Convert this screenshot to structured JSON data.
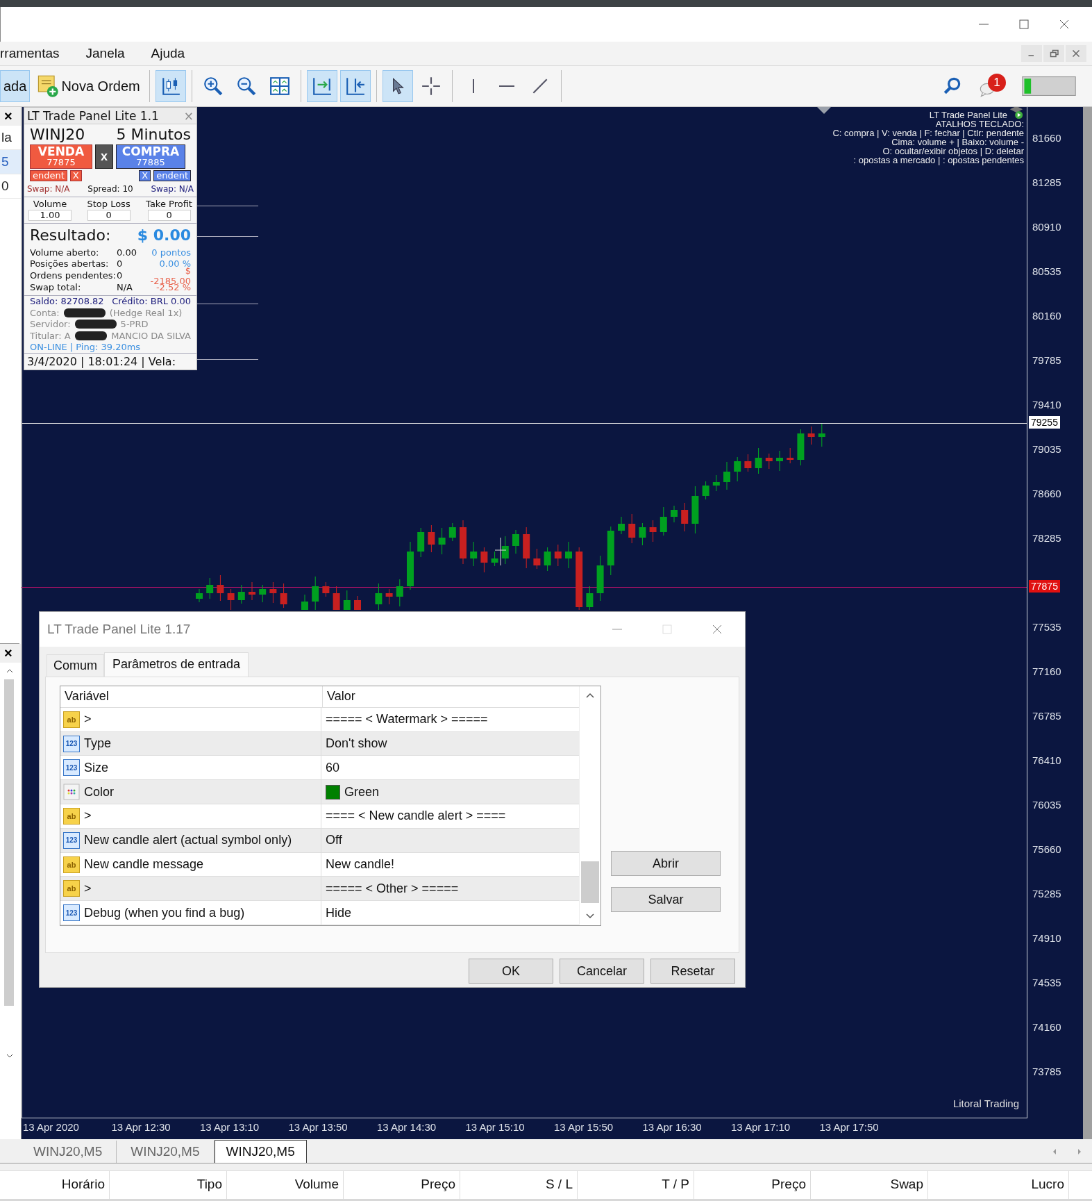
{
  "menu": [
    "rramentas",
    "Janela",
    "Ajuda"
  ],
  "toolbar": {
    "buttons": [
      {
        "label": "ada",
        "selected": true
      },
      {
        "label": "Nova Ordem",
        "selected": false
      }
    ],
    "tool_groups": [
      [
        {
          "selected": true
        }
      ],
      [
        {
          "selected": false
        },
        {
          "selected": false
        },
        {
          "selected": false
        }
      ],
      [
        {
          "selected": true
        },
        {
          "selected": true
        }
      ],
      [
        {
          "selected": true
        },
        {
          "selected": false
        }
      ],
      [
        {
          "selected": false
        },
        {
          "selected": false
        },
        {
          "selected": false
        }
      ]
    ],
    "notifications": "1"
  },
  "left_panel": {
    "close": "×",
    "items": [
      {
        "label": "la",
        "selected": false
      },
      {
        "label": "5",
        "selected": true
      },
      {
        "label": "0",
        "selected": false
      }
    ],
    "lower_close": "×"
  },
  "chart": {
    "info_lines": [
      "LT Trade Panel Lite",
      "ATALHOS TECLADO:",
      "C: compra  |  V: venda  |  F: fechar | Ctlr: pendente",
      "Cima: volume +  |  Baixo: volume -",
      "O: ocultar/exibir objetos  |  D: deletar",
      ": opostas a mercado  |  : opostas pendentes"
    ],
    "price_labels": [
      "81660",
      "81285",
      "80910",
      "80535",
      "80160",
      "79785",
      "79410",
      "79035",
      "78660",
      "78285",
      "77535",
      "77160",
      "76785",
      "76410",
      "76035",
      "75660",
      "75285",
      "74910",
      "74535",
      "74160",
      "73785"
    ],
    "current_price": "79255",
    "order_price": "77875",
    "time_labels": [
      "13 Apr 2020",
      "13 Apr 12:30",
      "13 Apr 13:10",
      "13 Apr 13:50",
      "13 Apr 14:30",
      "13 Apr 15:10",
      "13 Apr 15:50",
      "13 Apr 16:30",
      "13 Apr 17:10",
      "13 Apr 17:50"
    ],
    "broker_label": "Litoral Trading"
  },
  "trade_panel": {
    "title": "LT Trade Panel Lite 1.1",
    "close": "×",
    "symbol": "WINJ20",
    "timeframe": "5 Minutos",
    "sell": {
      "label": "VENDA",
      "price": "77875"
    },
    "close_all": "x",
    "buy": {
      "label": "COMPRA",
      "price": "77885"
    },
    "sell_pending": "endent",
    "sell_pending_close": "X",
    "buy_pending_close": "X",
    "buy_pending": "endent",
    "sell_swap": "Swap: N/A",
    "spread": "Spread: 10",
    "buy_swap": "Swap: N/A",
    "inputs": [
      {
        "label": "Volume",
        "value": "1.00"
      },
      {
        "label": "Stop Loss",
        "value": "0"
      },
      {
        "label": "Take Profit",
        "value": "0"
      }
    ],
    "result_label": "Resultado:",
    "result_value": "$ 0.00",
    "stats": [
      {
        "label": "Volume aberto:",
        "value": "0.00",
        "extra": "0 pontos",
        "color": "#3a8fe0"
      },
      {
        "label": "Posições abertas:",
        "value": "0",
        "extra": "0.00 %",
        "color": "#3a8fe0"
      },
      {
        "label": "Ordens pendentes:",
        "value": "0",
        "extra": "$ -2185.00",
        "color": "#e8604a"
      },
      {
        "label": "Swap total:",
        "value": "N/A",
        "extra": "-2.52 %",
        "color": "#e8604a"
      }
    ],
    "balance": {
      "label": "Saldo: 82708.82",
      "value": "Crédito: BRL 0.00"
    },
    "redacted": true,
    "account": [
      {
        "label": "Conta:",
        "value": "(Hedge Real 1x)"
      },
      {
        "label": "Servidor:",
        "value": "5-PRD"
      },
      {
        "label": "Titular: A",
        "value": "MANCIO DA SILVA"
      }
    ],
    "status": "ON-LINE | Ping: 39.20ms",
    "clock": "3/4/2020 | 18:01:24 | Vela:"
  },
  "dialog": {
    "title": "LT Trade Panel Lite 1.17",
    "tabs": [
      {
        "label": "Comum",
        "selected": false
      },
      {
        "label": "Parâmetros de entrada",
        "selected": true
      }
    ],
    "columns": [
      "Variável",
      "Valor"
    ],
    "rows": [
      {
        "kind": "text",
        "type_label": "ab",
        "name": ">",
        "value": "===== < Watermark > ====="
      },
      {
        "kind": "number",
        "type_label": "123",
        "name": "Type",
        "value": "Don't show"
      },
      {
        "kind": "number",
        "type_label": "123",
        "name": "Size",
        "value": "60"
      },
      {
        "kind": "color",
        "name": "Color",
        "value": "Green",
        "color": "#008000"
      },
      {
        "kind": "text",
        "type_label": "ab",
        "name": ">",
        "value": "==== < New candle alert > ===="
      },
      {
        "kind": "number",
        "type_label": "123",
        "name": "New candle alert (actual symbol only)",
        "value": "Off"
      },
      {
        "kind": "text",
        "type_label": "ab",
        "name": "New candle message",
        "value": "New candle!"
      },
      {
        "kind": "text",
        "type_label": "ab",
        "name": ">",
        "value": "===== < Other > ====="
      },
      {
        "kind": "number",
        "type_label": "123",
        "name": "Debug (when you find a bug)",
        "value": "Hide"
      }
    ],
    "side_buttons": [
      "Abrir",
      "Salvar"
    ],
    "buttons": [
      "OK",
      "Cancelar",
      "Resetar"
    ]
  },
  "chart_tabs": [
    {
      "label": "WINJ20,M5",
      "selected": false
    },
    {
      "label": "WINJ20,M5",
      "selected": false
    },
    {
      "label": "WINJ20,M5",
      "selected": true
    }
  ],
  "trade_columns": [
    "Horário",
    "Tipo",
    "Volume",
    "Preço",
    "S / L",
    "T / P",
    "Preço",
    "Swap",
    "Lucro"
  ]
}
